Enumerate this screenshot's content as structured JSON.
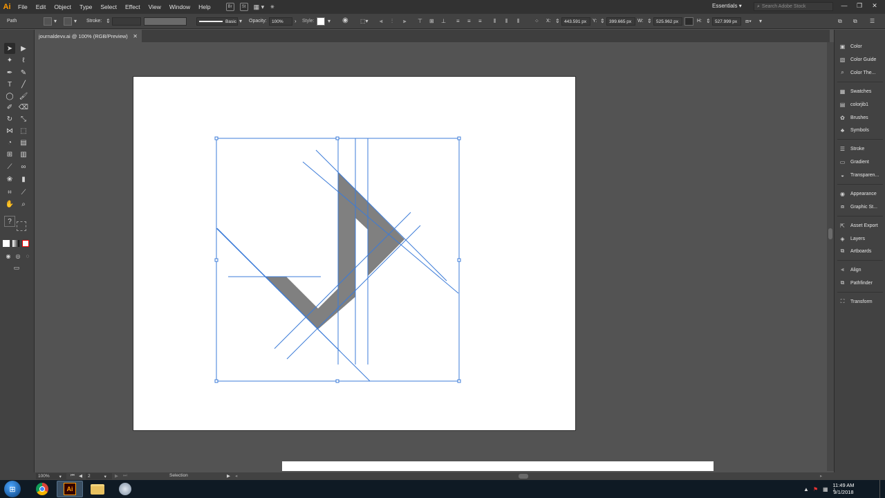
{
  "app": {
    "logo": "Ai"
  },
  "menu": [
    "File",
    "Edit",
    "Object",
    "Type",
    "Select",
    "Effect",
    "View",
    "Window",
    "Help"
  ],
  "menu_icons": [
    "Br",
    "St"
  ],
  "workspace": "Essentials",
  "search_placeholder": "Search Adobe Stock",
  "control": {
    "selection_type": "Path",
    "stroke_label": "Stroke:",
    "brush_label": "Basic",
    "opacity_label": "Opacity:",
    "opacity_value": "100%",
    "style_label": "Style:",
    "x_label": "X:",
    "x_value": "443.591 px",
    "y_label": "Y:",
    "y_value": "399.665 px",
    "w_label": "W:",
    "w_value": "525.962 px",
    "h_label": "H:",
    "h_value": "527.999 px"
  },
  "document_tab": {
    "title": "journaldevv.ai @ 100% (RGB/Preview)"
  },
  "panels": [
    {
      "label": "Color",
      "icon": "color-icon"
    },
    {
      "label": "Color Guide",
      "icon": "color-guide-icon"
    },
    {
      "label": "Color The...",
      "icon": "color-themes-icon"
    },
    {
      "label": "Swatches",
      "icon": "swatches-icon"
    },
    {
      "label": "colorjib1",
      "icon": "library-icon"
    },
    {
      "label": "Brushes",
      "icon": "brushes-icon"
    },
    {
      "label": "Symbols",
      "icon": "symbols-icon"
    },
    {
      "label": "Stroke",
      "icon": "stroke-icon"
    },
    {
      "label": "Gradient",
      "icon": "gradient-icon"
    },
    {
      "label": "Transparen...",
      "icon": "transparency-icon"
    },
    {
      "label": "Appearance",
      "icon": "appearance-icon"
    },
    {
      "label": "Graphic St...",
      "icon": "graphic-styles-icon"
    },
    {
      "label": "Asset Export",
      "icon": "asset-export-icon"
    },
    {
      "label": "Layers",
      "icon": "layers-icon"
    },
    {
      "label": "Artboards",
      "icon": "artboards-icon"
    },
    {
      "label": "Align",
      "icon": "align-icon"
    },
    {
      "label": "Pathfinder",
      "icon": "pathfinder-icon"
    },
    {
      "label": "Transform",
      "icon": "transform-icon"
    }
  ],
  "status": {
    "zoom": "100%",
    "artboard_number": "2",
    "tool_name": "Selection"
  },
  "taskbar": {
    "time": "11:49 AM",
    "date": "9/1/2018"
  },
  "colors": {
    "accent": "#ff9a00",
    "guide": "#3b7bd8",
    "shape": "#808080"
  }
}
